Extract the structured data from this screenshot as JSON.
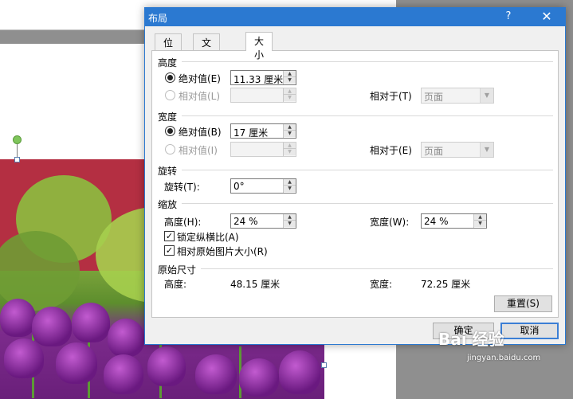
{
  "dialog": {
    "title": "布局",
    "help": "?",
    "close": "✕"
  },
  "tabs": [
    "位置",
    "文字环绕",
    "大小"
  ],
  "height": {
    "heading": "高度",
    "absolute_label": "绝对值(E)",
    "absolute_value": "11.33 厘米",
    "relative_label": "相对值(L)",
    "relative_to_label": "相对于(T)",
    "relative_to_value": "页面"
  },
  "width": {
    "heading": "宽度",
    "absolute_label": "绝对值(B)",
    "absolute_value": "17 厘米",
    "relative_label": "相对值(I)",
    "relative_to_label": "相对于(E)",
    "relative_to_value": "页面"
  },
  "rotation": {
    "heading": "旋转",
    "label": "旋转(T):",
    "value": "0°"
  },
  "scale": {
    "heading": "缩放",
    "height_label": "高度(H):",
    "height_value": "24 %",
    "width_label": "宽度(W):",
    "width_value": "24 %",
    "lock_aspect": "锁定纵横比(A)",
    "relative_original": "相对原始图片大小(R)"
  },
  "original": {
    "heading": "原始尺寸",
    "height_label": "高度:",
    "height_value": "48.15 厘米",
    "width_label": "宽度:",
    "width_value": "72.25 厘米",
    "reset": "重置(S)"
  },
  "buttons": {
    "ok": "确定",
    "cancel": "取消"
  },
  "watermark": {
    "brand": "Bai 经验",
    "url": "jingyan.baidu.com"
  }
}
